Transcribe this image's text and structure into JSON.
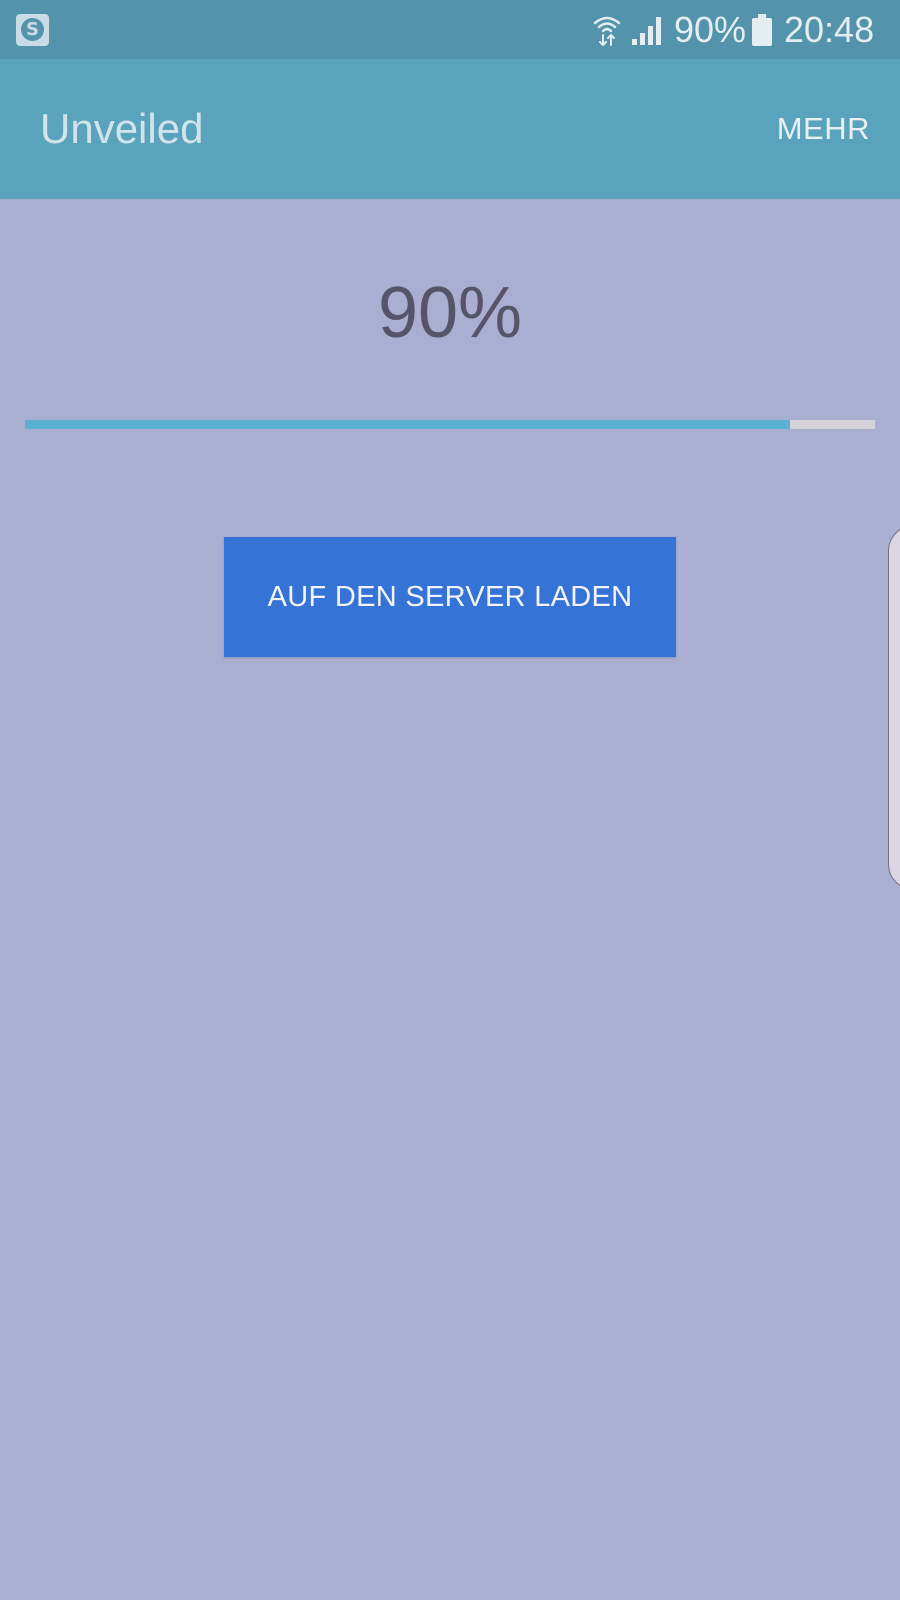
{
  "status_bar": {
    "app_icon": "s-shield-icon",
    "wifi_icon": "wifi-data-icon",
    "signal_icon": "cell-signal-icon",
    "battery_percent": "90%",
    "battery_icon": "battery-icon",
    "time": "20:48"
  },
  "app_bar": {
    "title": "Unveiled",
    "menu_label": "MEHR"
  },
  "main": {
    "progress_text": "90%",
    "progress_fraction": 0.9,
    "upload_button_label": "AUF DEN SERVER LADEN"
  },
  "colors": {
    "status_bar": "#5393ac",
    "app_bar": "#59a3bd",
    "background": "#aaaed1",
    "progress_fill": "#5bb1d2",
    "progress_track": "#d6d2d9",
    "button": "#3573d6"
  }
}
